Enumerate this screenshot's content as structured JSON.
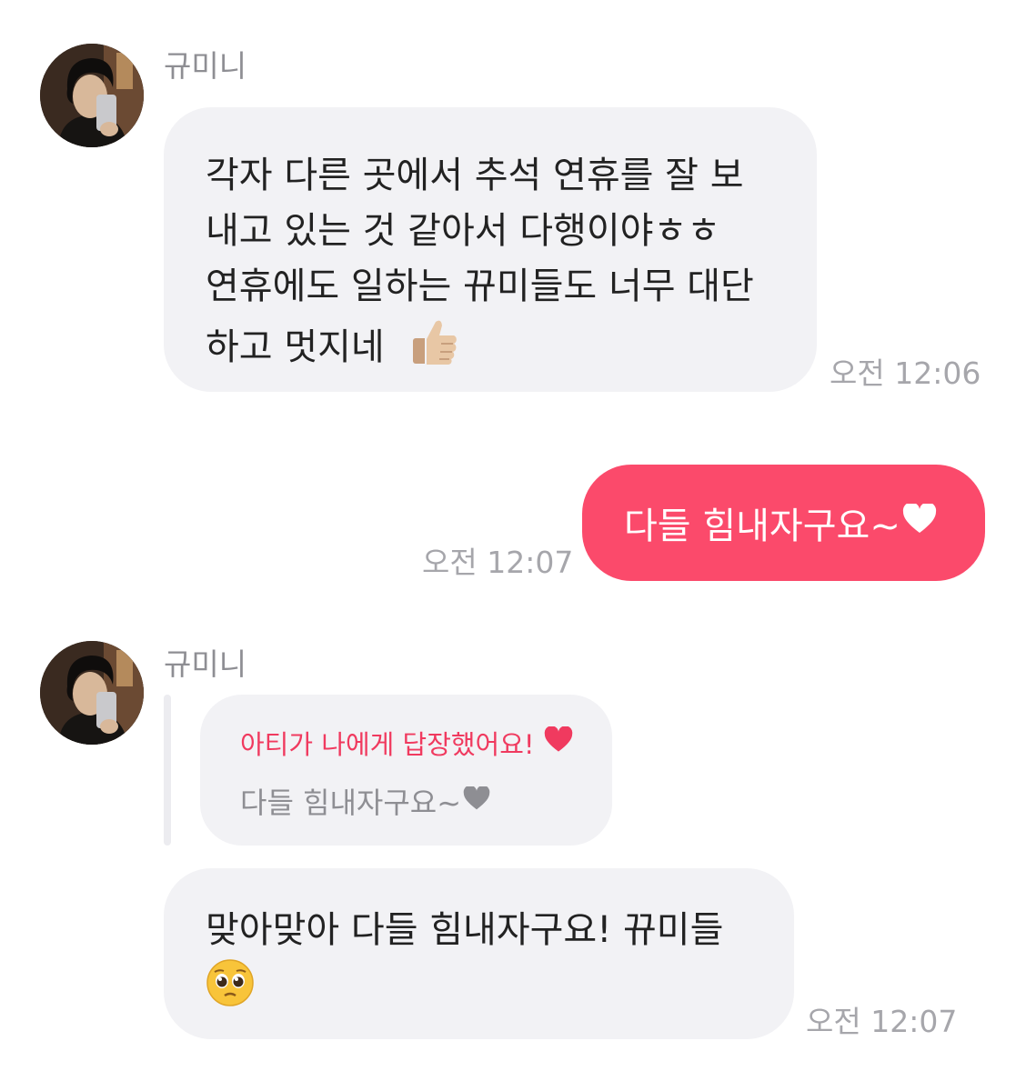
{
  "messages": [
    {
      "sender": "규미니",
      "lines": [
        "각자 다른 곳에서 추석 연휴를 잘 보",
        "내고 있는 것 같아서 다행이야ㅎㅎ",
        "연휴에도 일하는 뀨미들도 너무 대단",
        "하고 멋지네"
      ],
      "emoji": "thumbs-up-icon",
      "time": "오전 12:06"
    },
    {
      "text": "다들 힘내자구요~",
      "emoji": "white-heart-icon",
      "time": "오전 12:07"
    },
    {
      "sender": "규미니",
      "reply": {
        "header": "아티가 나에게 답장했어요!",
        "header_icon": "red-heart-icon",
        "quote": "다들 힘내자구요~",
        "quote_icon": "gray-heart-icon"
      },
      "lines": [
        "맞아맞아 다들 힘내자구요! 뀨미들"
      ],
      "emoji": "pleading-face-icon",
      "time": "오전 12:07"
    }
  ],
  "colors": {
    "incoming_bubble": "#f2f2f5",
    "outgoing_bubble": "#fb4a6b",
    "reply_accent": "#f03a5f",
    "timestamp": "#a6a6ab"
  }
}
